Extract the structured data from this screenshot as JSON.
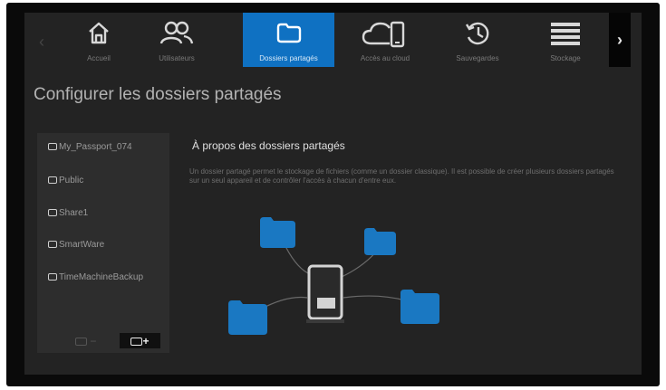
{
  "nav": {
    "items": [
      {
        "label": "Accueil",
        "icon": "home-icon"
      },
      {
        "label": "Utilisateurs",
        "icon": "users-icon"
      },
      {
        "label": "Dossiers partagés",
        "icon": "folder-icon",
        "active": true
      },
      {
        "label": "Accès au cloud",
        "icon": "cloud-device-icon"
      },
      {
        "label": "Sauvegardes",
        "icon": "history-icon"
      },
      {
        "label": "Stockage",
        "icon": "stack-icon"
      }
    ],
    "prev_icon": "chevron-left-icon",
    "next_icon": "chevron-right-icon"
  },
  "page_title": "Configurer les dossiers partagés",
  "shares": {
    "items": [
      "My_Passport_074",
      "Public",
      "Share1",
      "SmartWare",
      "TimeMachineBackup"
    ],
    "remove_label": "−",
    "add_label": "+"
  },
  "about": {
    "title": "À propos des dossiers partagés",
    "description": "Un dossier partagé permet le stockage de fichiers (comme un dossier classique). Il est possible de créer plusieurs dossiers partagés sur un seul appareil et de contrôler l'accès à chacun d'entre eux."
  },
  "colors": {
    "accent": "#0f71c2",
    "background": "#232323",
    "folder_blue": "#1a78c2"
  }
}
